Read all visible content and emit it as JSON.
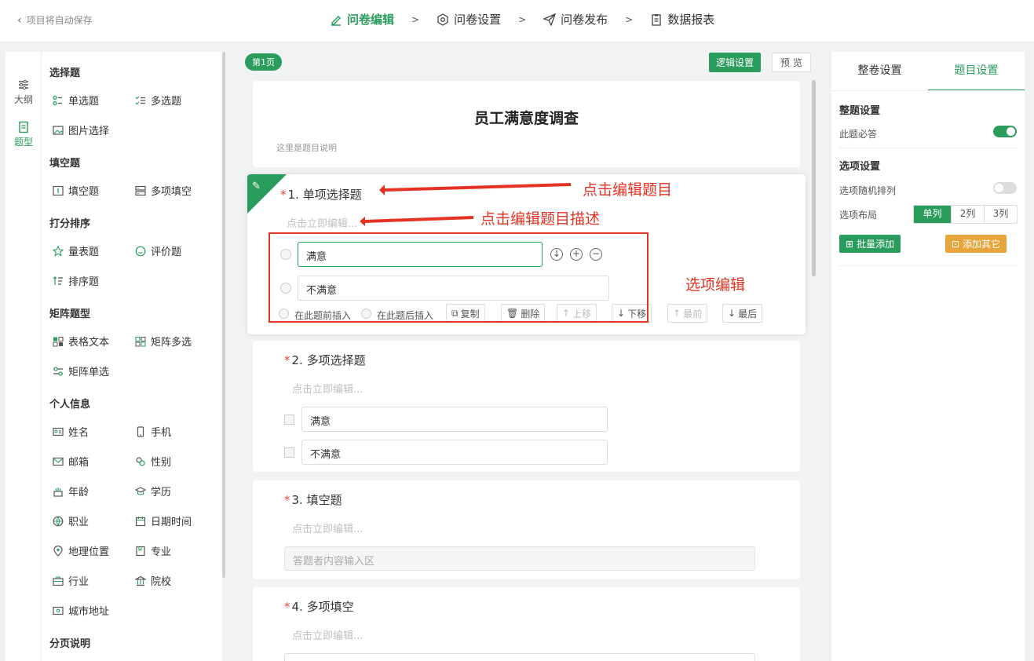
{
  "header": {
    "back_label": "项目将自动保存",
    "steps": [
      "问卷编辑",
      "问卷设置",
      "问卷发布",
      "数据报表"
    ],
    "sep": ">"
  },
  "rail": {
    "outline": "大纲",
    "types": "题型"
  },
  "palette": {
    "groups": [
      "选择题",
      "填空题",
      "打分排序",
      "矩阵题型",
      "个人信息",
      "分页说明"
    ],
    "items": {
      "single": "单选题",
      "multi": "多选题",
      "image": "图片选择",
      "fill": "填空题",
      "multifill": "多项填空",
      "scale": "量表题",
      "rating": "评价题",
      "sort": "排序题",
      "tabletext": "表格文本",
      "matrixmulti": "矩阵多选",
      "matrixsingle": "矩阵单选",
      "name": "姓名",
      "phone": "手机",
      "email": "邮箱",
      "gender": "性别",
      "age": "年龄",
      "edu": "学历",
      "job": "职业",
      "datetime": "日期时间",
      "location": "地理位置",
      "major": "专业",
      "industry": "行业",
      "school": "院校",
      "city": "城市地址"
    }
  },
  "center": {
    "page_badge": "第1页",
    "logic_btn": "逻辑设置",
    "preview_btn": "预 览",
    "survey_title": "员工满意度调查",
    "survey_desc": "这里是题目说明",
    "desc_placeholder": "点击立即编辑...",
    "q1": {
      "num": "1.",
      "title": "单项选择题",
      "opt1": "满意",
      "opt2": "不满意"
    },
    "q2": {
      "num": "2.",
      "title": "多项选择题",
      "opt1": "满意",
      "opt2": "不满意"
    },
    "q3": {
      "num": "3.",
      "title": "填空题",
      "input": "答题者内容输入区"
    },
    "q4": {
      "num": "4.",
      "title": "多项填空"
    },
    "toolbar": {
      "insert_before": "在此题前插入",
      "insert_after": "在此题后插入",
      "copy": "复制",
      "delete": "删除",
      "up": "上移",
      "down": "下移",
      "top": "最前",
      "bottom": "最后"
    }
  },
  "annotations": {
    "edit_title": "点击编辑题目",
    "edit_desc": "点击编辑题目描述",
    "edit_options": "选项编辑"
  },
  "right": {
    "tab_whole": "整卷设置",
    "tab_question": "题目设置",
    "section1": "整题设置",
    "required": "此题必答",
    "section2": "选项设置",
    "random": "选项随机排列",
    "layout": "选项布局",
    "layout_options": [
      "单列",
      "2列",
      "3列"
    ],
    "batch_add": "批量添加",
    "add_other": "添加其它"
  },
  "colors": {
    "accent": "#2a9d5c",
    "annotation": "#e53323",
    "orange": "#e8a53c"
  }
}
